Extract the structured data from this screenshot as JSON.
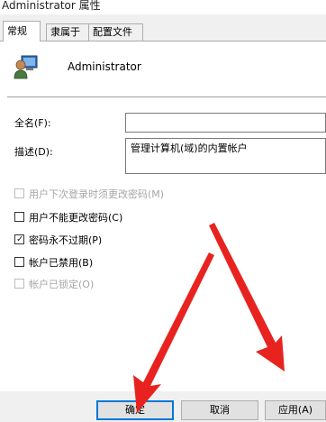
{
  "window": {
    "title": "Administrator 属性"
  },
  "tabs": [
    {
      "label": "常规",
      "active": true
    },
    {
      "label": "隶属于",
      "active": false
    },
    {
      "label": "配置文件",
      "active": false
    }
  ],
  "user": {
    "name": "Administrator"
  },
  "fields": {
    "fullname_label": "全名(F):",
    "fullname_value": "",
    "description_label": "描述(D):",
    "description_value": "管理计算机(域)的内置帐户"
  },
  "options": [
    {
      "label": "用户下次登录时须更改密码(M)",
      "checked": false,
      "disabled": true
    },
    {
      "label": "用户不能更改密码(C)",
      "checked": false,
      "disabled": false
    },
    {
      "label": "密码永不过期(P)",
      "checked": true,
      "disabled": false
    },
    {
      "label": "帐户已禁用(B)",
      "checked": false,
      "disabled": false
    },
    {
      "label": "帐户已锁定(O)",
      "checked": false,
      "disabled": true
    }
  ],
  "buttons": {
    "ok": "确定",
    "cancel": "取消",
    "apply": "应用(A)"
  },
  "annotation": {
    "arrow_color": "#e8231f"
  }
}
